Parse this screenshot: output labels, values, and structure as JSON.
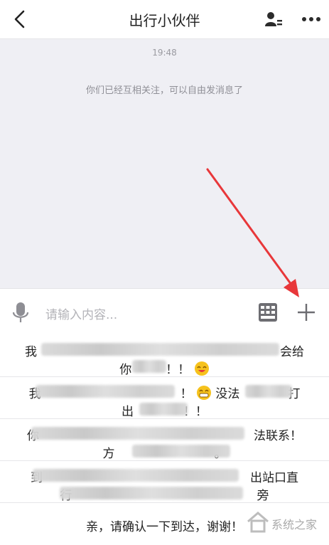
{
  "header": {
    "back_icon": "chevron-left-icon",
    "title": "出行小伙伴",
    "person_icon": "contact-card-icon",
    "more_icon": "more-dots-icon"
  },
  "chat": {
    "time": "19:48",
    "notice": "你们已经互相关注，可以自由发消息了"
  },
  "annotation": {
    "arrow_color": "#e8373a"
  },
  "input": {
    "mic_icon": "microphone-icon",
    "placeholder": "请输入内容...",
    "keyboard_icon": "grid-keyboard-icon",
    "plus_icon": "plus-icon"
  },
  "quick_replies": [
    {
      "line1a": "我",
      "line1b": "会给",
      "line2a": "你",
      "line2b": "！！"
    },
    {
      "line1a": "我",
      "line1b": "！",
      "line1c": "没法",
      "line1d": "打",
      "line2a": "出",
      "line2b": "！！"
    },
    {
      "line1a": "你",
      "line1b": "法联系！",
      "line2a": "方",
      "line2b": "。"
    },
    {
      "line1a": "到",
      "line1b": "出站口直",
      "line2a": "行",
      "line2b": "旁"
    },
    {
      "line1a": "亲，请确认一下到达，谢谢！"
    }
  ],
  "watermark": {
    "text": "系统之家"
  },
  "colors": {
    "chat_bg": "#efeff4",
    "divider": "#e6e6e9",
    "emoji": "#f6c21c"
  }
}
